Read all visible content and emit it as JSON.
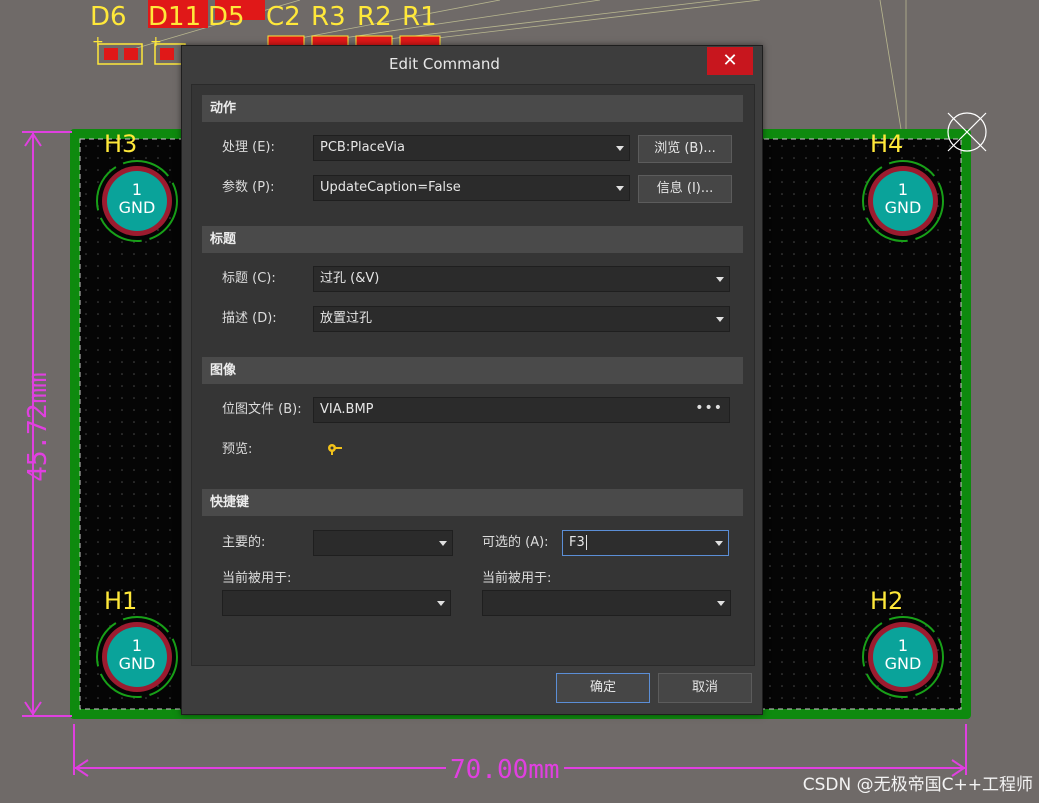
{
  "pcb": {
    "component_labels": [
      "D6",
      "D11",
      "D5",
      "C2",
      "R3",
      "R2",
      "R1"
    ],
    "holes": [
      {
        "name": "H3",
        "pad_number": "1",
        "net": "GND"
      },
      {
        "name": "H4",
        "pad_number": "1",
        "net": "GND"
      },
      {
        "name": "H1",
        "pad_number": "1",
        "net": "GND"
      },
      {
        "name": "H2",
        "pad_number": "1",
        "net": "GND"
      }
    ],
    "dimension_vertical": "45.72mm",
    "dimension_horizontal": "70.00mm",
    "colors": {
      "board_outline": "#0e8a0e",
      "board_fill": "#050505",
      "dimension": "#e040e0",
      "silk": "#ffe83a",
      "pad_fill": "#0aa39a",
      "pad_ring": "#9c1b2f"
    }
  },
  "watermark": "CSDN @无极帝国C++工程师",
  "dialog": {
    "title": "Edit Command",
    "close_label": "✕",
    "sections": {
      "action": "动作",
      "caption": "标题",
      "image": "图像",
      "shortcut": "快捷键"
    },
    "process": {
      "label": "处理 (E):",
      "value": "PCB:PlaceVia",
      "button": "浏览 (B)..."
    },
    "params": {
      "label": "参数 (P):",
      "value": "UpdateCaption=False",
      "button": "信息 (I)..."
    },
    "caption_field": {
      "label": "标题 (C):",
      "value": "过孔 (&V)"
    },
    "description": {
      "label": "描述 (D):",
      "value": "放置过孔"
    },
    "bitmap": {
      "label": "位图文件 (B):",
      "value": "VIA.BMP",
      "browse_icon": "ellipsis-icon"
    },
    "preview": {
      "label": "预览:",
      "icon": "via-preview-icon"
    },
    "primary": {
      "label": "主要的:",
      "value": ""
    },
    "alternate": {
      "label": "可选的 (A):",
      "value": "F3"
    },
    "used_by_primary": {
      "label": "当前被用于:",
      "value": ""
    },
    "used_by_alternate": {
      "label": "当前被用于:",
      "value": ""
    },
    "ok_label": "确定",
    "cancel_label": "取消",
    "accent_color": "#5b8ed6",
    "close_color": "#c8161e"
  }
}
